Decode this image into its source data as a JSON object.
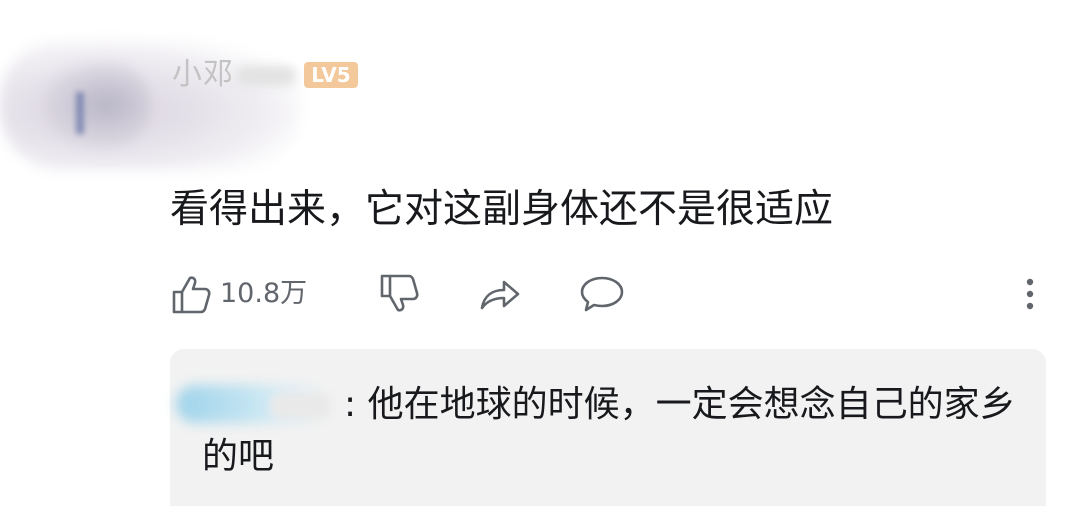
{
  "comment": {
    "username": "小邓",
    "level_badge": "LV5",
    "text": "看得出来，它对这副身体还不是很适应"
  },
  "actions": {
    "like_count": "10.8万",
    "like_icon": "thumbs-up-icon",
    "dislike_icon": "thumbs-down-icon",
    "share_icon": "share-icon",
    "reply_icon": "comment-bubble-icon",
    "more_icon": "more-vertical-icon"
  },
  "reply": {
    "separator": ":",
    "text": " 他在地球的时候，一定会想念自己的家乡的吧"
  },
  "colors": {
    "text_primary": "#18191c",
    "text_secondary": "#61666d",
    "reply_background": "#f2f2f2",
    "level_badge": "#f3c99b"
  }
}
